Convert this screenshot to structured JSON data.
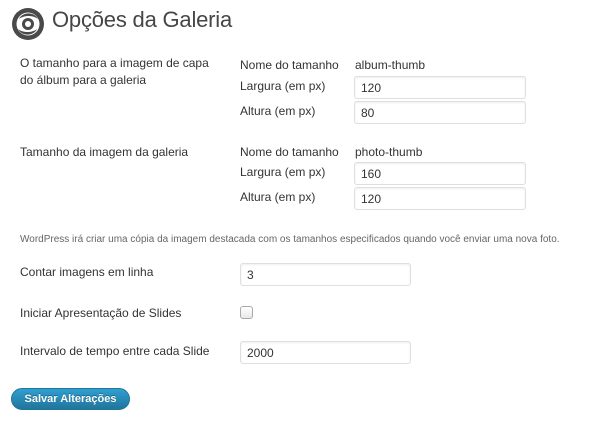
{
  "page": {
    "title": "Opções da Galeria"
  },
  "album": {
    "label_line1": "O tamanho para a imagem de capa",
    "label_line2": "do álbum para a galeria",
    "name_label": "Nome do tamanho",
    "name_value": "album-thumb",
    "width_label": "Largura (em px)",
    "width_value": "120",
    "height_label": "Altura (em px)",
    "height_value": "80"
  },
  "photo": {
    "label": "Tamanho da imagem da galeria",
    "name_label": "Nome do tamanho",
    "name_value": "photo-thumb",
    "width_label": "Largura (em px)",
    "width_value": "160",
    "height_label": "Altura (em px)",
    "height_value": "120"
  },
  "description": "WordPress irá criar uma cópia da imagem destacada com os tamanhos especificados quando você enviar uma nova foto.",
  "count": {
    "label": "Contar imagens em linha",
    "value": "3"
  },
  "slideshow": {
    "label": "Iniciar Apresentação de Slides",
    "checked": false
  },
  "interval": {
    "label": "Intervalo de tempo entre cada Slide",
    "value": "2000"
  },
  "save_button": {
    "label": "Salvar Alterações",
    "color": "#21759b"
  },
  "icons": {
    "logo": "gallery-logo-icon"
  }
}
